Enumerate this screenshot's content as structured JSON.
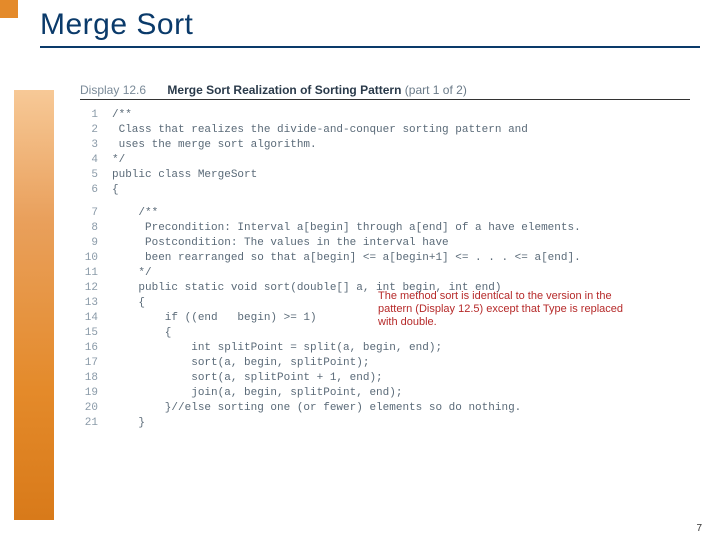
{
  "title": "Merge Sort",
  "display": {
    "label": "Display",
    "num": "12.6",
    "title": "Merge Sort Realization of Sorting Pattern",
    "part": "(part 1 of 2)"
  },
  "code": [
    {
      "n": "1",
      "t": "/**"
    },
    {
      "n": "2",
      "t": " Class that realizes the divide-and-conquer sorting pattern and"
    },
    {
      "n": "3",
      "t": " uses the merge sort algorithm."
    },
    {
      "n": "4",
      "t": "*/"
    },
    {
      "n": "5",
      "t": "public class MergeSort"
    },
    {
      "n": "6",
      "t": "{"
    }
  ],
  "code2": [
    {
      "n": "7",
      "t": "    /**"
    },
    {
      "n": "8",
      "t": "     Precondition: Interval a[begin] through a[end] of a have elements."
    },
    {
      "n": "9",
      "t": "     Postcondition: The values in the interval have"
    },
    {
      "n": "10",
      "t": "     been rearranged so that a[begin] <= a[begin+1] <= . . . <= a[end]."
    },
    {
      "n": "11",
      "t": "    */"
    },
    {
      "n": "12",
      "t": "    public static void sort(double[] a, int begin, int end)"
    },
    {
      "n": "13",
      "t": "    {"
    },
    {
      "n": "14",
      "t": "        if ((end   begin) >= 1)"
    },
    {
      "n": "15",
      "t": "        {"
    },
    {
      "n": "16",
      "t": "            int splitPoint = split(a, begin, end);"
    },
    {
      "n": "17",
      "t": "            sort(a, begin, splitPoint);"
    },
    {
      "n": "18",
      "t": "            sort(a, splitPoint + 1, end);"
    },
    {
      "n": "19",
      "t": "            join(a, begin, splitPoint, end);"
    },
    {
      "n": "20",
      "t": "        }//else sorting one (or fewer) elements so do nothing."
    },
    {
      "n": "21",
      "t": "    }"
    }
  ],
  "annotation": {
    "l1": "The method sort is identical to the version in the",
    "l2": "pattern (Display 12.5) except that Type is replaced",
    "l3": "with double."
  },
  "page": "7"
}
